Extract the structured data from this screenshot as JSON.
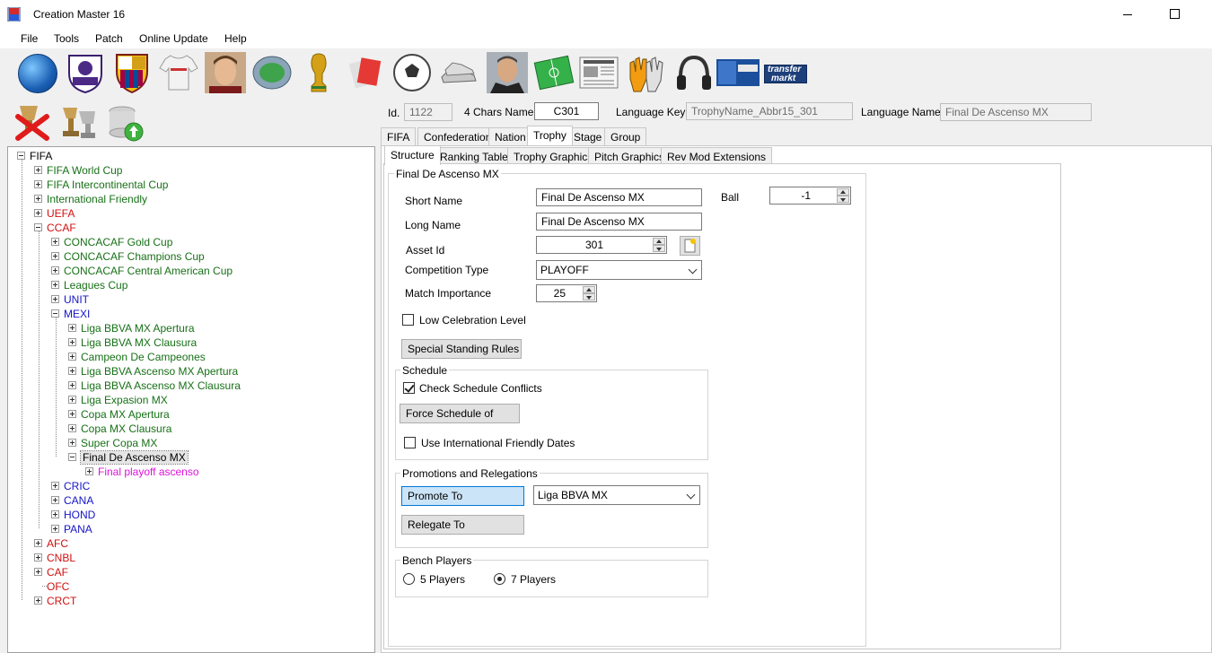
{
  "window": {
    "title": "Creation Master 16"
  },
  "menu": [
    "File",
    "Tools",
    "Patch",
    "Online Update",
    "Help"
  ],
  "toolbar_icons": [
    "globe-icon",
    "premier-league-icon",
    "fc-barcelona-icon",
    "jersey-icon",
    "player-face-icon",
    "stadium-icon",
    "world-cup-trophy-icon",
    "referee-cards-icon",
    "football-icon",
    "boots-icon",
    "manager-face-icon",
    "pitch-icon",
    "newspaper-icon",
    "goalkeeper-gloves-icon",
    "headphones-icon",
    "fifa-cover-icon",
    "transfermarkt-icon"
  ],
  "transfermarkt_text": [
    "transfer",
    "markt"
  ],
  "header": {
    "id_label": "Id.",
    "id_value": "1122",
    "chars_label": "4 Chars Name",
    "chars_value": "C301",
    "lang_key_label": "Language Key",
    "lang_key_value": "TrophyName_Abbr15_301",
    "lang_name_label": "Language Name",
    "lang_name_value": "Final De Ascenso MX"
  },
  "tabs": [
    "FIFA",
    "Confederation",
    "Nation",
    "Trophy",
    "Stage",
    "Group"
  ],
  "subtabs": [
    "Structure",
    "Ranking Table",
    "Trophy Graphics",
    "Pitch Graphics",
    "Rev Mod Extensions"
  ],
  "tree": {
    "root": "FIFA",
    "items": [
      {
        "label": "FIFA World Cup",
        "color": "#177017"
      },
      {
        "label": "FIFA Intercontinental Cup",
        "color": "#177017"
      },
      {
        "label": "International Friendly",
        "color": "#177017"
      },
      {
        "label": "UEFA",
        "color": "#d01010"
      },
      {
        "label": "CCAF",
        "color": "#d01010"
      },
      {
        "label": "CONCACAF Gold Cup",
        "color": "#177017"
      },
      {
        "label": "CONCACAF Champions Cup",
        "color": "#177017"
      },
      {
        "label": "CONCACAF Central American Cup",
        "color": "#177017"
      },
      {
        "label": "Leagues Cup",
        "color": "#177017"
      },
      {
        "label": "UNIT",
        "color": "#1414c8"
      },
      {
        "label": "MEXI",
        "color": "#1414c8"
      },
      {
        "label": "Liga BBVA MX Apertura",
        "color": "#177017"
      },
      {
        "label": "Liga BBVA MX Clausura",
        "color": "#177017"
      },
      {
        "label": "Campeon De Campeones",
        "color": "#177017"
      },
      {
        "label": "Liga BBVA Ascenso MX Apertura",
        "color": "#177017"
      },
      {
        "label": "Liga BBVA Ascenso MX  Clausura",
        "color": "#177017"
      },
      {
        "label": "Liga Expasion MX",
        "color": "#177017"
      },
      {
        "label": "Copa MX Apertura",
        "color": "#177017"
      },
      {
        "label": "Copa MX Clausura",
        "color": "#177017"
      },
      {
        "label": "Super Copa MX",
        "color": "#177017"
      },
      {
        "label": "Final De Ascenso MX",
        "color": "#000000"
      },
      {
        "label": "Final playoff ascenso",
        "color": "#dd11dd"
      },
      {
        "label": "CRIC",
        "color": "#1414c8"
      },
      {
        "label": "CANA",
        "color": "#1414c8"
      },
      {
        "label": "HOND",
        "color": "#1414c8"
      },
      {
        "label": "PANA",
        "color": "#1414c8"
      },
      {
        "label": "AFC",
        "color": "#d01010"
      },
      {
        "label": "CNBL",
        "color": "#d01010"
      },
      {
        "label": "CAF",
        "color": "#d01010"
      },
      {
        "label": "OFC",
        "color": "#d01010"
      },
      {
        "label": "CRCT",
        "color": "#d01010"
      }
    ]
  },
  "structure": {
    "group_title": "Final De Ascenso MX",
    "short_name_label": "Short Name",
    "short_name_value": "Final De Ascenso MX",
    "long_name_label": "Long Name",
    "long_name_value": "Final De Ascenso MX",
    "asset_id_label": "Asset Id",
    "asset_id_value": "301",
    "comp_type_label": "Competition Type",
    "comp_type_value": "PLAYOFF",
    "match_importance_label": "Match Importance",
    "match_importance_value": "25",
    "ball_label": "Ball",
    "ball_value": "-1",
    "low_celebration_label": "Low Celebration Level",
    "low_celebration_checked": false,
    "special_standing_button": "Special Standing Rules",
    "schedule": {
      "title": "Schedule",
      "check_conflicts_label": "Check Schedule Conflicts",
      "check_conflicts_checked": true,
      "force_button": "Force Schedule of",
      "intl_dates_label": "Use International Friendly Dates",
      "intl_dates_checked": false
    },
    "promotions": {
      "title": "Promotions and Relegations",
      "promote_button": "Promote To",
      "promote_value": "Liga BBVA MX",
      "relegate_button": "Relegate To"
    },
    "bench": {
      "title": "Bench Players",
      "opt5": "5 Players",
      "opt7": "7 Players",
      "selected": "7 Players"
    }
  }
}
